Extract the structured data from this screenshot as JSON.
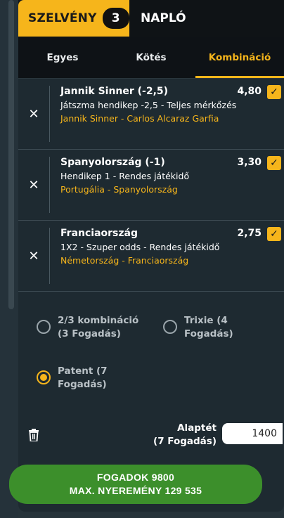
{
  "tabs": {
    "betslip_label": "SZELVÉNY",
    "betslip_count": "3",
    "log_label": "NAPLÓ"
  },
  "bet_types": [
    "Egyes",
    "Kötés",
    "Kombináció"
  ],
  "bet_type_active": "Kombináció",
  "bets": [
    {
      "title": "Jannik Sinner (-2,5)",
      "market": "Játszma hendikep -2,5 - Teljes mérkőzés",
      "event": "Jannik Sinner - Carlos Alcaraz Garfia",
      "odds": "4,80",
      "selected": true
    },
    {
      "title": "Spanyolország (-1)",
      "market": "Hendikep 1 - Rendes játékidő",
      "event": "Portugália - Spanyolország",
      "odds": "3,30",
      "selected": true
    },
    {
      "title": "Franciaország",
      "market": "1X2 - Szuper odds - Rendes játékidő",
      "event": "Németország - Franciaország",
      "odds": "2,75",
      "selected": true
    }
  ],
  "systems": [
    {
      "line1": "2/3 kombináció",
      "line2": "(3 Fogadás)",
      "selected": false
    },
    {
      "line1": "Trixie (4",
      "line2": "Fogadás)",
      "selected": false
    },
    {
      "line1": "Patent (7",
      "line2": "Fogadás)",
      "selected": true
    }
  ],
  "stake": {
    "label_line1": "Alaptét",
    "label_line2": "(7 Fogadás)",
    "value": "1400"
  },
  "place_bet": {
    "line1": "FOGADOK 9800",
    "line2": "MAX. NYEREMÉNY 129 535"
  },
  "colors": {
    "accent": "#f6b51b",
    "button": "#3c8f2b",
    "panel": "#1e2a31"
  },
  "icons": {
    "remove": "close-icon",
    "checkbox": "check-icon",
    "trash": "trash-icon"
  }
}
